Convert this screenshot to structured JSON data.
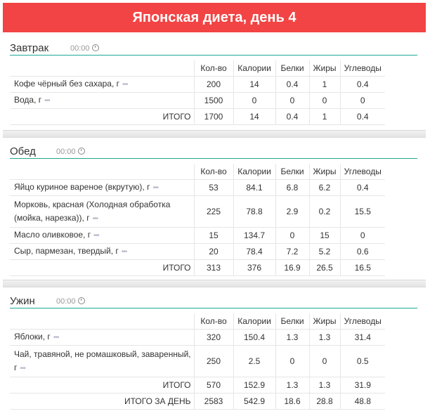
{
  "page_title": "Японская диета, день 4",
  "columns": [
    "Кол-во",
    "Калории",
    "Белки",
    "Жиры",
    "Углеводы"
  ],
  "meals": [
    {
      "name": "Завтрак",
      "time": "00:00",
      "items": [
        {
          "name": "Кофе чёрный без сахара, г",
          "qty": "200",
          "cal": "14",
          "prot": "0.4",
          "fat": "1",
          "carb": "0.4"
        },
        {
          "name": "Вода, г",
          "qty": "1500",
          "cal": "0",
          "prot": "0",
          "fat": "0",
          "carb": "0"
        }
      ],
      "total": {
        "label": "ИТОГО",
        "qty": "1700",
        "cal": "14",
        "prot": "0.4",
        "fat": "1",
        "carb": "0.4"
      }
    },
    {
      "name": "Обед",
      "time": "00:00",
      "items": [
        {
          "name": "Яйцо куриное вареное (вкрутую), г",
          "qty": "53",
          "cal": "84.1",
          "prot": "6.8",
          "fat": "6.2",
          "carb": "0.4"
        },
        {
          "name": "Морковь, красная (Холодная обработка (мойка, нарезка)), г",
          "qty": "225",
          "cal": "78.8",
          "prot": "2.9",
          "fat": "0.2",
          "carb": "15.5"
        },
        {
          "name": "Масло оливковое, г",
          "qty": "15",
          "cal": "134.7",
          "prot": "0",
          "fat": "15",
          "carb": "0"
        },
        {
          "name": "Сыр, пармезан, твердый, г",
          "qty": "20",
          "cal": "78.4",
          "prot": "7.2",
          "fat": "5.2",
          "carb": "0.6"
        }
      ],
      "total": {
        "label": "ИТОГО",
        "qty": "313",
        "cal": "376",
        "prot": "16.9",
        "fat": "26.5",
        "carb": "16.5"
      }
    },
    {
      "name": "Ужин",
      "time": "00:00",
      "items": [
        {
          "name": "Яблоки, г",
          "qty": "320",
          "cal": "150.4",
          "prot": "1.3",
          "fat": "1.3",
          "carb": "31.4"
        },
        {
          "name": "Чай, травяной, не ромашковый, заваренный, г",
          "qty": "250",
          "cal": "2.5",
          "prot": "0",
          "fat": "0",
          "carb": "0.5"
        }
      ],
      "total": {
        "label": "ИТОГО",
        "qty": "570",
        "cal": "152.9",
        "prot": "1.3",
        "fat": "1.3",
        "carb": "31.9"
      },
      "day_total": {
        "label": "ИТОГО ЗА ДЕНЬ",
        "qty": "2583",
        "cal": "542.9",
        "prot": "18.6",
        "fat": "28.8",
        "carb": "48.8"
      }
    }
  ],
  "icons": {
    "time": "clock-icon",
    "more": "more-dots-icon"
  },
  "colors": {
    "header_bg": "#f24444",
    "accent_line": "#1fa895"
  }
}
